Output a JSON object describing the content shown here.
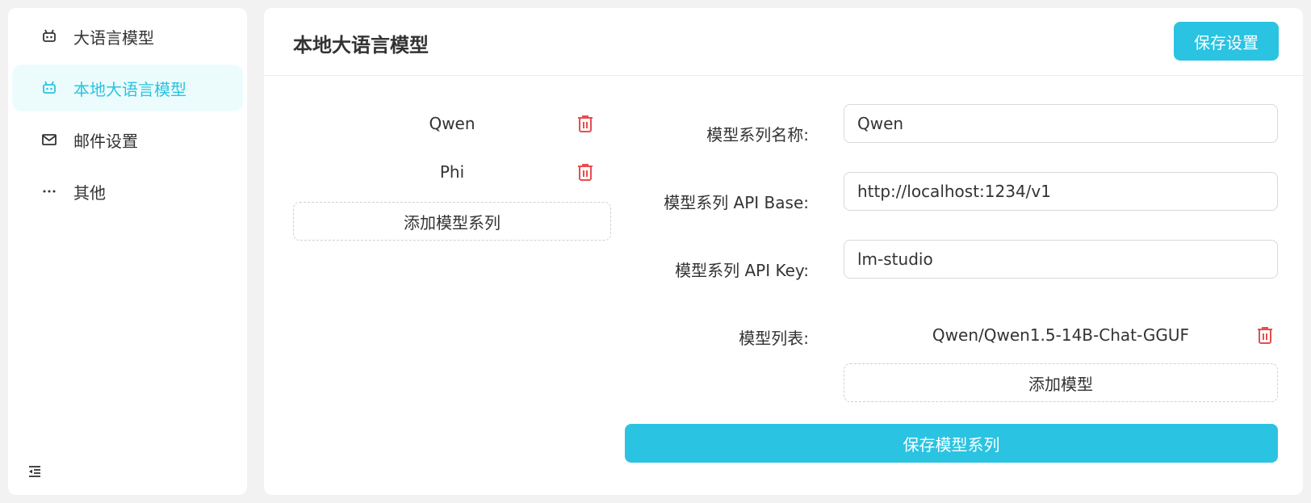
{
  "sidebar": {
    "items": [
      {
        "label": "大语言模型",
        "icon": "robot-icon"
      },
      {
        "label": "本地大语言模型",
        "icon": "robot-icon",
        "active": true
      },
      {
        "label": "邮件设置",
        "icon": "mail-icon"
      },
      {
        "label": "其他",
        "icon": "more-icon"
      }
    ],
    "collapse_icon": "collapse-menu-icon"
  },
  "header": {
    "title": "本地大语言模型",
    "save_label": "保存设置"
  },
  "series_list": {
    "items": [
      {
        "name": "Qwen"
      },
      {
        "name": "Phi"
      }
    ],
    "add_label": "添加模型系列"
  },
  "form": {
    "name_label": "模型系列名称:",
    "name_value": "Qwen",
    "api_base_label": "模型系列 API Base:",
    "api_base_value": "http://localhost:1234/v1",
    "api_key_label": "模型系列 API Key:",
    "api_key_value": "lm-studio",
    "models_label": "模型列表:",
    "models": [
      {
        "name": "Qwen/Qwen1.5-14B-Chat-GGUF"
      }
    ],
    "add_model_label": "添加模型",
    "save_series_label": "保存模型系列"
  },
  "colors": {
    "accent": "#2ac3e2",
    "active_bg": "#ecfcfd",
    "danger": "#e84d4d",
    "text": "#333333",
    "page_bg": "#f2f2f2"
  }
}
